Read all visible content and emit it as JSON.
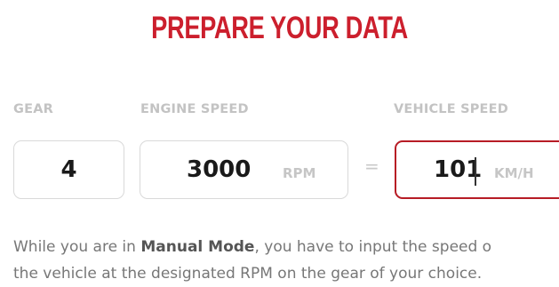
{
  "header": {
    "title": "PREPARE YOUR DATA"
  },
  "fields": {
    "gear": {
      "label": "GEAR",
      "value": "4"
    },
    "engine_speed": {
      "label": "ENGINE SPEED",
      "value": "3000",
      "unit": "RPM"
    },
    "equals": "=",
    "vehicle_speed": {
      "label": "VEHICLE SPEED",
      "value": "101",
      "unit": "KM/H"
    }
  },
  "description": {
    "part1": "While you are in ",
    "bold": "Manual Mode",
    "part2": ", you have to input the speed o",
    "line2": "the vehicle at the designated RPM on the gear of your choice."
  },
  "colors": {
    "accent": "#cc1f2d",
    "active_border": "#b71c25",
    "label": "#c3c3c3",
    "border": "#d9d9d9"
  }
}
